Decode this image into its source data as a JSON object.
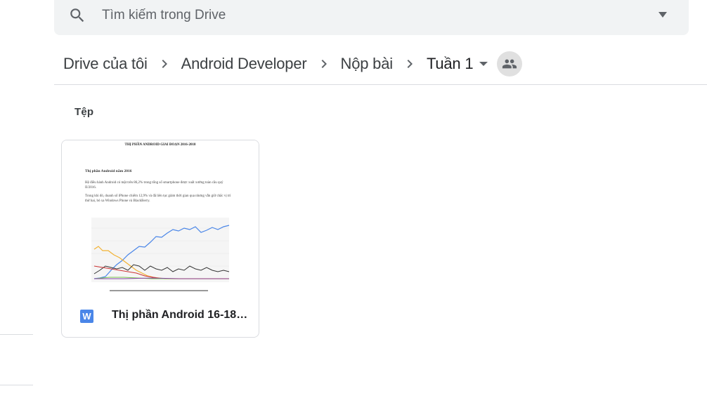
{
  "search": {
    "placeholder": "Tìm kiếm trong Drive",
    "icon": "search-icon",
    "options_icon": "dropdown-arrow-icon"
  },
  "breadcrumb": {
    "items": [
      "Drive của tôi",
      "Android Developer",
      "Nộp bài",
      "Tuần 1"
    ],
    "separator_icon": "chevron-right-icon",
    "menu_icon": "dropdown-arrow-icon",
    "shared_icon": "people-icon"
  },
  "files_section": {
    "title": "Tệp"
  },
  "file": {
    "name": "Thị phần Android 16-18.docx",
    "type_letter": "W",
    "type_color": "#4a86e8",
    "preview": {
      "doc_title": "THỊ PHẦN ANDROID GIAI ĐOẠN 2016-2018",
      "heading": "Thị phần Android năm 2016",
      "para1": "Hệ điều hành Android có mặt trên 86,2% trong tổng số smartphone được xuất xưởng toàn cầu quý II/2016.",
      "para2": "Trong khi đó, doanh số iPhone chiếm 12,9% và đã liên tục giảm thời gian qua nhưng vẫn giữ chắc vị trí thứ hai, bỏ xa Windows Phone và BlackBerry."
    }
  },
  "colors": {
    "search_bg": "#f1f3f4",
    "divider": "#dadce0",
    "text": "#202124"
  }
}
